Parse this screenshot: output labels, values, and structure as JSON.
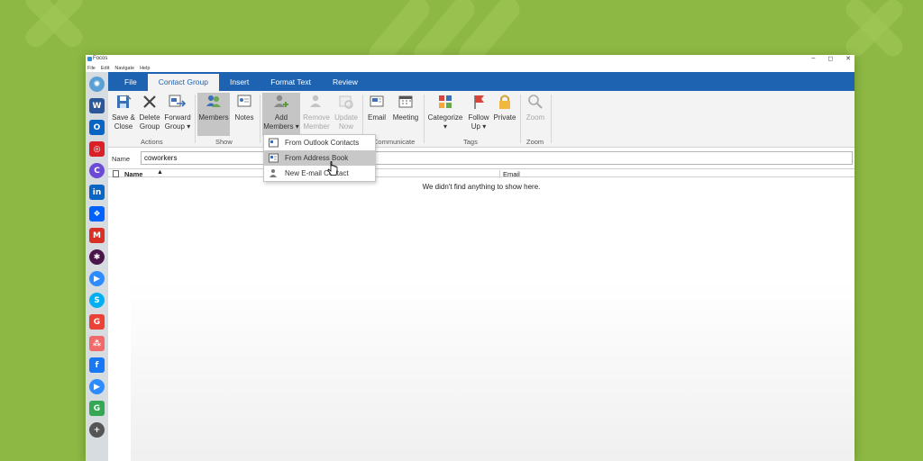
{
  "window": {
    "title": "Focos",
    "controls": [
      "–",
      "◻",
      "✕"
    ],
    "menu": [
      "File",
      "Edit",
      "Navigate",
      "Help"
    ]
  },
  "dock": {
    "apps": [
      {
        "name": "focos",
        "glyph": "✺",
        "color": "#5aa0d6"
      },
      {
        "name": "word",
        "glyph": "W",
        "color": "#2b579a"
      },
      {
        "name": "outlook",
        "glyph": "O",
        "color": "#0a64c4"
      },
      {
        "name": "creative-cloud",
        "glyph": "◎",
        "color": "#da1f26"
      },
      {
        "name": "canva",
        "glyph": "C",
        "color": "#6c4ad8"
      },
      {
        "name": "linkedin",
        "glyph": "in",
        "color": "#0a66c2"
      },
      {
        "name": "dropbox",
        "glyph": "❖",
        "color": "#0061ff"
      },
      {
        "name": "gmail",
        "glyph": "M",
        "color": "#d93025"
      },
      {
        "name": "slack",
        "glyph": "✱",
        "color": "#4a154b"
      },
      {
        "name": "zoom",
        "glyph": "▶",
        "color": "#2d8cff"
      },
      {
        "name": "skype",
        "glyph": "S",
        "color": "#00aff0"
      },
      {
        "name": "google",
        "glyph": "G",
        "color": "#ea4335"
      },
      {
        "name": "asana",
        "glyph": "⁂",
        "color": "#f06a6a"
      },
      {
        "name": "facebook",
        "glyph": "f",
        "color": "#1877f2"
      },
      {
        "name": "zoom-2",
        "glyph": "▶",
        "color": "#2d8cff"
      },
      {
        "name": "google-2",
        "glyph": "G",
        "color": "#34a853"
      },
      {
        "name": "add-app",
        "glyph": "+",
        "color": "#555555"
      }
    ]
  },
  "tabs": [
    "File",
    "Contact Group",
    "Insert",
    "Format Text",
    "Review"
  ],
  "active_tab": "Contact Group",
  "ribbon": {
    "actions": {
      "save_close": "Save &",
      "save_close_2": "Close",
      "delete": "Delete",
      "delete_2": "Group",
      "forward": "Forward",
      "forward_2": "Group ▾",
      "group_label": "Actions"
    },
    "show": {
      "members": "Members",
      "notes": "Notes",
      "group_label": "Show"
    },
    "members": {
      "add": "Add",
      "add_2": "Members ▾",
      "remove": "Remove",
      "remove_2": "Member",
      "update": "Update",
      "update_2": "Now"
    },
    "communicate": {
      "email": "Email",
      "meeting": "Meeting",
      "group_label": "Communicate"
    },
    "tags": {
      "categorize": "Categorize",
      "categorize_2": "▾",
      "follow_up": "Follow",
      "follow_up_2": "Up ▾",
      "private": "Private",
      "group_label": "Tags"
    },
    "zoom": {
      "zoom": "Zoom",
      "group_label": "Zoom"
    }
  },
  "dropdown": {
    "items": [
      "From Outlook Contacts",
      "From Address Book",
      "New E-mail Contact"
    ],
    "highlighted": "From Address Book"
  },
  "form": {
    "name_label": "Name",
    "name_value": "coworkers"
  },
  "list": {
    "col_name": "Name",
    "sort_indicator": "▲",
    "col_email": "Email",
    "empty_message": "We didn't find anything to show here."
  }
}
